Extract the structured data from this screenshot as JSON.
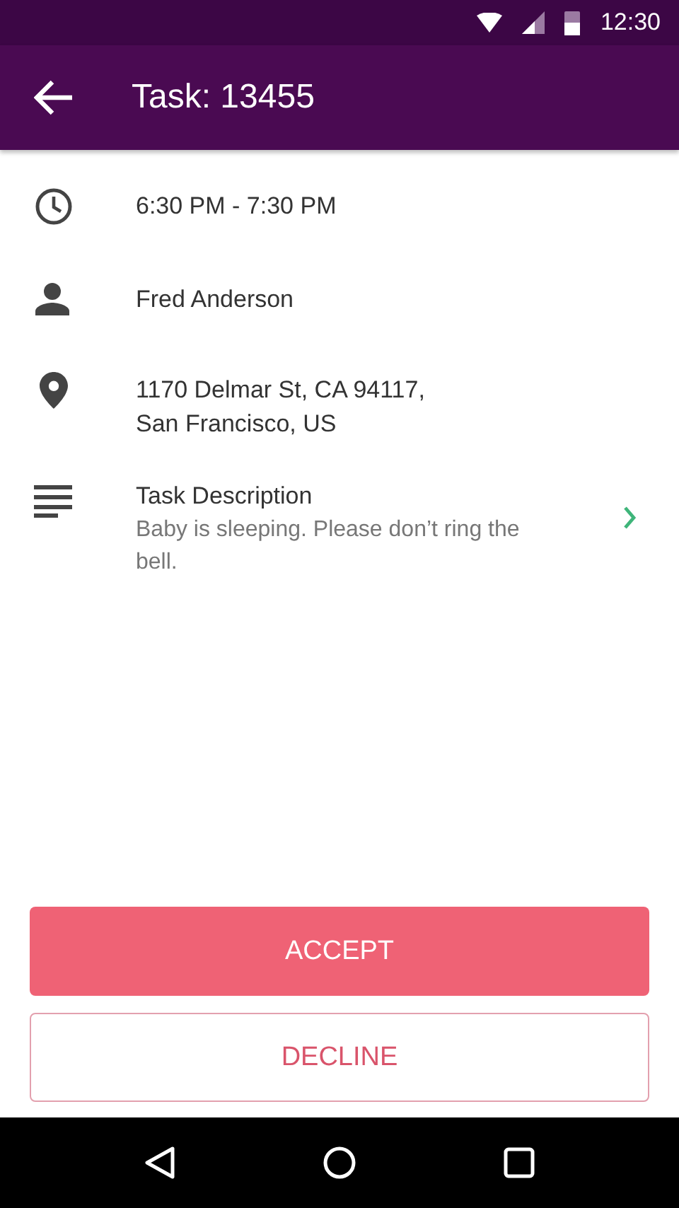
{
  "status_bar": {
    "time": "12:30"
  },
  "app_bar": {
    "title": "Task: 13455"
  },
  "details": [
    {
      "kind": "time",
      "lines": [
        "6:30 PM - 7:30 PM"
      ]
    },
    {
      "kind": "person",
      "lines": [
        "Fred Anderson"
      ]
    },
    {
      "kind": "location",
      "lines": [
        "1170 Delmar St, CA 94117,",
        "San Francisco, US"
      ]
    },
    {
      "kind": "description",
      "title": "Task Description",
      "text": "Baby is sleeping. Please don’t ring the bell."
    }
  ],
  "buttons": [
    {
      "label": "ACCEPT",
      "kind": "primary"
    },
    {
      "label": "DECLINE",
      "kind": "outline"
    }
  ]
}
